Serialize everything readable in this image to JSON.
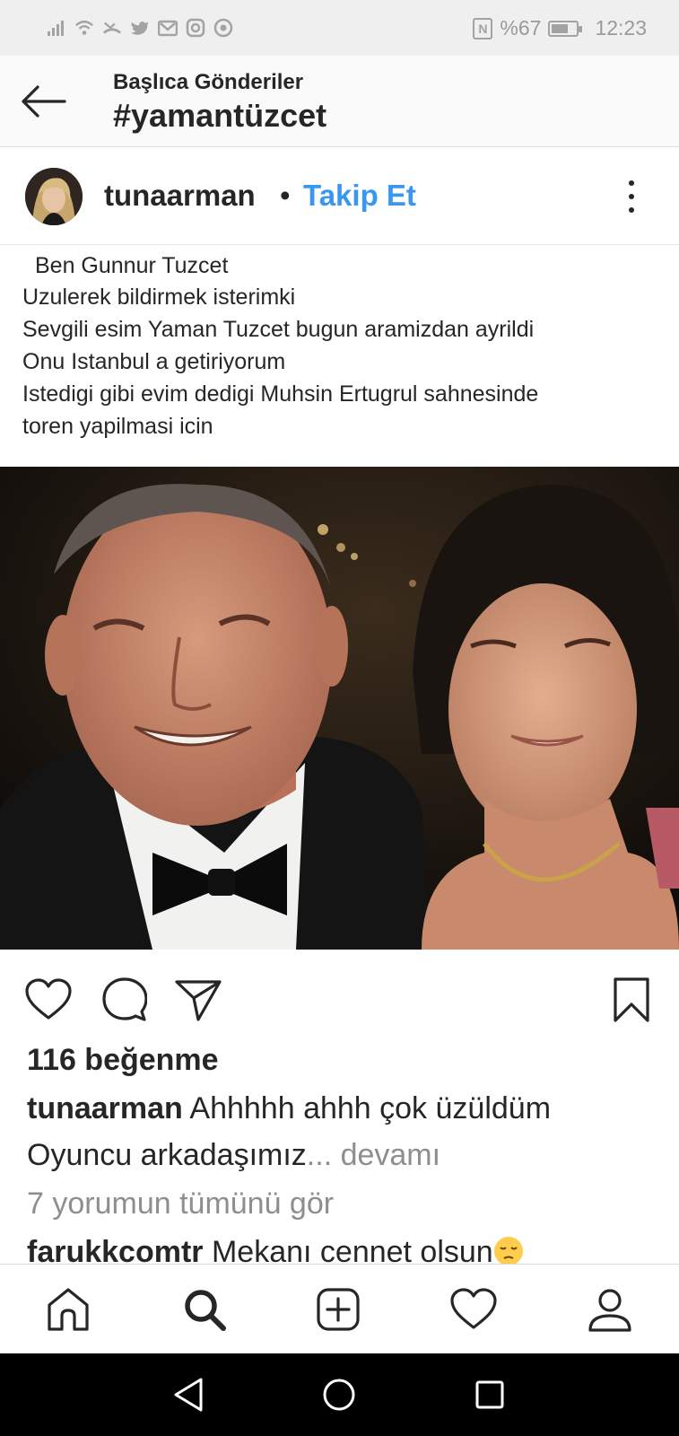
{
  "status_bar": {
    "battery_text": "%67",
    "battery_level": 0.67,
    "time": "12:23"
  },
  "header": {
    "subtitle": "Başlıca Gönderiler",
    "title": "#yamantüzcet"
  },
  "post": {
    "username": "tunaarman",
    "separator": "•",
    "follow_label": "Takip Et",
    "caption_lines": [
      "Ben Gunnur Tuzcet",
      "Uzulerek bildirmek isterimki",
      "Sevgili esim Yaman Tuzcet bugun aramizdan ayrildi",
      "Onu Istanbul a getiriyorum",
      "Istedigi gibi evim dedigi Muhsin Ertugrul sahnesinde",
      "toren yapilmasi icin"
    ],
    "likes_text": "116 beğenme",
    "caption_user": "tunaarman",
    "caption_text": " Ahhhhh ahhh çok üzüldüm",
    "caption_line2": "Oyuncu arkadaşımız",
    "more_label": "... devamı",
    "view_all_comments": "7 yorumun tümünü gör",
    "comment_user": "farukkcomtr",
    "comment_text": " Mekanı cennet olsun"
  },
  "icons": {
    "back": "arrow-left-icon",
    "like": "heart-icon",
    "comment": "comment-bubble-icon",
    "share": "paper-plane-icon",
    "save": "bookmark-icon",
    "home": "home-icon",
    "search": "search-icon",
    "add": "plus-square-icon",
    "activity": "heart-icon",
    "profile": "person-icon"
  },
  "colors": {
    "follow_blue": "#3897f0",
    "text": "#262626",
    "muted": "#8e8e8e"
  }
}
